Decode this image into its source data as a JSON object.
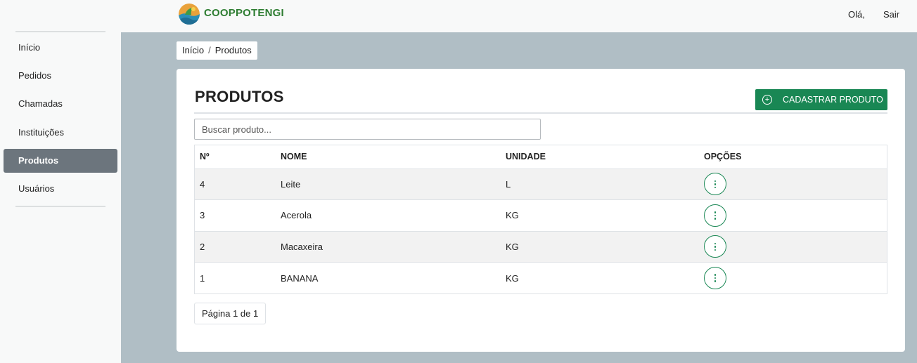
{
  "header": {
    "brand": "COOPPOTENGI",
    "greeting": "Olá,",
    "logout_label": "Sair"
  },
  "sidebar": {
    "items": [
      {
        "label": "Início",
        "active": false
      },
      {
        "label": "Pedidos",
        "active": false
      },
      {
        "label": "Chamadas",
        "active": false
      },
      {
        "label": "Instituições",
        "active": false
      },
      {
        "label": "Produtos",
        "active": true
      },
      {
        "label": "Usuários",
        "active": false
      }
    ]
  },
  "breadcrumb": {
    "items": [
      "Início",
      "Produtos"
    ],
    "separator": "/"
  },
  "main": {
    "title": "PRODUTOS",
    "add_button_label": "CADASTRAR PRODUTO",
    "search_placeholder": "Buscar produto...",
    "table": {
      "headers": [
        "Nº",
        "NOME",
        "UNIDADE",
        "OPÇÕES"
      ],
      "rows": [
        {
          "number": "4",
          "name": "Leite",
          "unit": "L"
        },
        {
          "number": "3",
          "name": "Acerola",
          "unit": "KG"
        },
        {
          "number": "2",
          "name": "Macaxeira",
          "unit": "KG"
        },
        {
          "number": "1",
          "name": "BANANA",
          "unit": "KG"
        }
      ]
    },
    "pagination": "Página 1 de 1"
  },
  "colors": {
    "accent": "#198754",
    "brand_text": "#2e7d32",
    "sidebar_active": "#6c757d",
    "content_bg": "#b0bec5"
  },
  "icons": {
    "logo": "coppotengi-logo-icon",
    "add": "plus-circle-icon",
    "options": "vertical-dots-icon"
  }
}
